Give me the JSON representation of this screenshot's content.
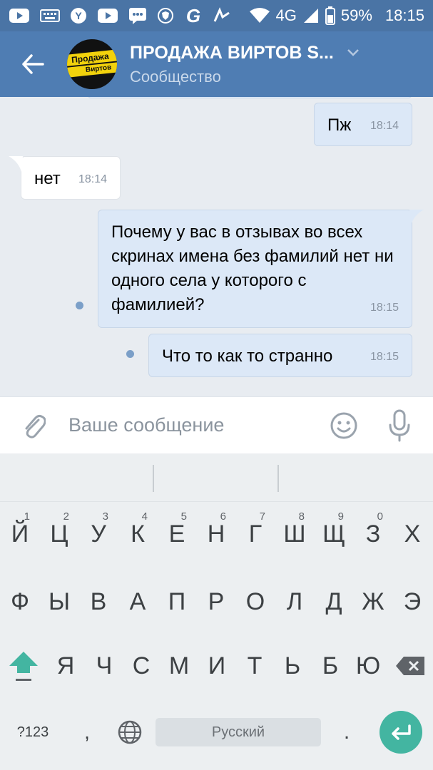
{
  "status_bar": {
    "network": "4G",
    "battery": "59%",
    "time": "18:15"
  },
  "header": {
    "title": "ПРОДАЖА ВИРТОВ S...",
    "subtitle": "Сообщество",
    "avatar_line1": "Продажа",
    "avatar_line2": "Виртов"
  },
  "messages": [
    {
      "text": "Пж",
      "time": "18:14"
    },
    {
      "text": "нет",
      "time": "18:14"
    },
    {
      "text": "Почему у вас в отзывах во всех скринах имена без фамилий нет ни одного села у которого с фамилией?",
      "time": "18:15"
    },
    {
      "text": "Что то как то странно",
      "time": "18:15"
    }
  ],
  "input": {
    "placeholder": "Ваше сообщение"
  },
  "keyboard": {
    "row1": [
      "Й",
      "Ц",
      "У",
      "К",
      "Е",
      "Н",
      "Г",
      "Ш",
      "Щ",
      "З",
      "Х"
    ],
    "row1_nums": [
      "1",
      "2",
      "3",
      "4",
      "5",
      "6",
      "7",
      "8",
      "9",
      "0"
    ],
    "row2": [
      "Ф",
      "Ы",
      "В",
      "А",
      "П",
      "Р",
      "О",
      "Л",
      "Д",
      "Ж",
      "Э"
    ],
    "row3": [
      "Я",
      "Ч",
      "С",
      "М",
      "И",
      "Т",
      "Ь",
      "Б",
      "Ю"
    ],
    "symbols_label": "?123",
    "comma": ",",
    "period": ".",
    "space_label": "Русский"
  },
  "colors": {
    "header": "#4f7db3",
    "status_bar": "#4a74a5",
    "outgoing_bubble": "#dce8f7",
    "enter_key": "#43b5a1"
  }
}
